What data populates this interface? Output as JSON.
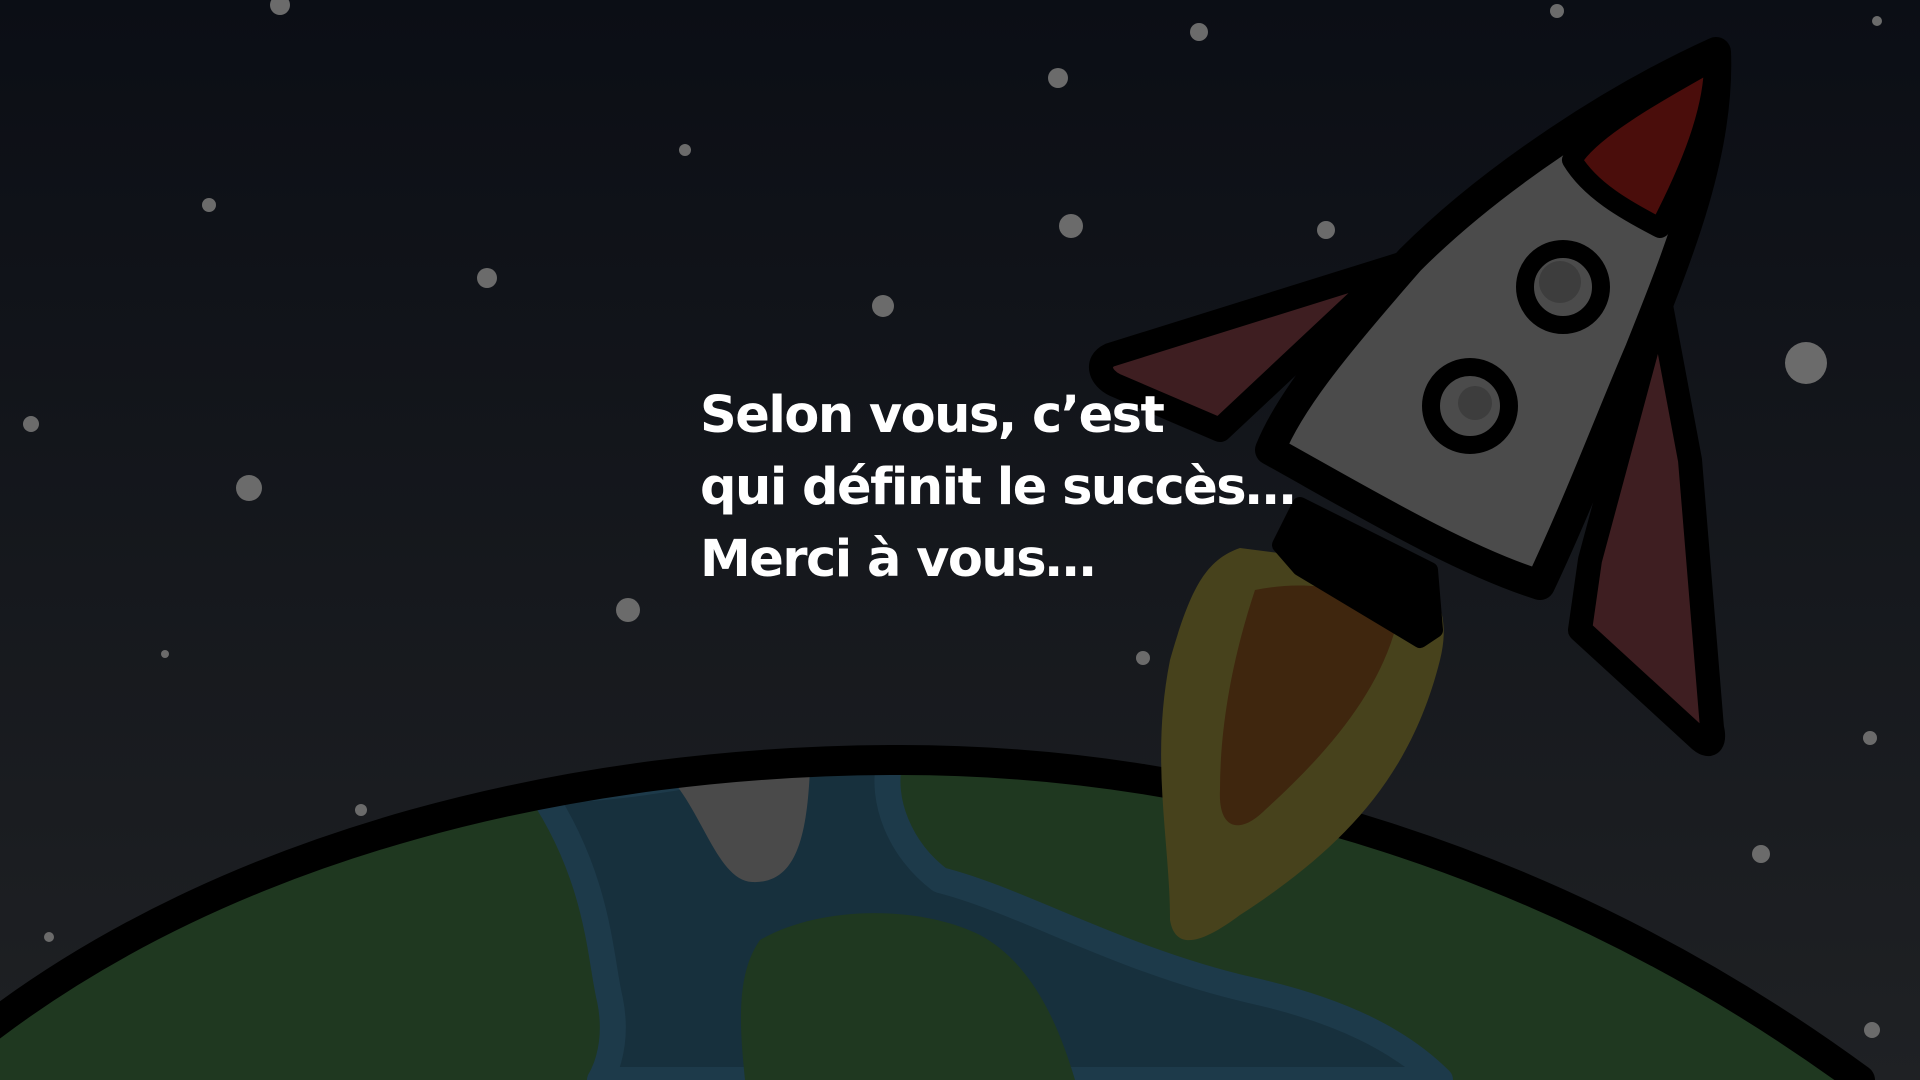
{
  "slide": {
    "lines": [
      "Selon vous, c’est",
      "qui définit le succès…",
      "Merci à vous…"
    ]
  },
  "illustration": {
    "icon_names": [
      "rocket-icon",
      "planet-earth-icon",
      "star-icon",
      "flame-icon"
    ],
    "colors": {
      "sky_top": "#0b0e15",
      "sky_bottom": "#1f2124",
      "star": "#6b6b6b",
      "land": "#1f3820",
      "water": "#17303d",
      "water_edge": "#1d3a4a",
      "snow": "#4a4a4a",
      "rocket_body": "#4b4b4b",
      "rocket_fin": "#3e1e21",
      "rocket_nose": "#4a0d0b",
      "flame_outer": "#47421c",
      "flame_inner": "#3f260e",
      "outline": "#000000",
      "text": "#ffffff"
    }
  }
}
